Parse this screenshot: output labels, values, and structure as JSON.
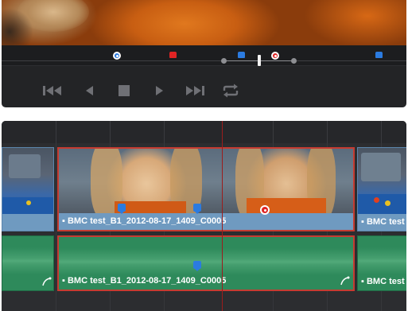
{
  "viewer": {
    "scrubber_markers": [
      {
        "name": "marker-blue-ring",
        "color": "#2b7be0",
        "style": "ring"
      },
      {
        "name": "marker-red",
        "color": "#e02424",
        "style": "flag"
      },
      {
        "name": "marker-blue",
        "color": "#2b7be0",
        "style": "flag"
      },
      {
        "name": "marker-red-ring",
        "color": "#e02424",
        "style": "ring"
      },
      {
        "name": "marker-blue",
        "color": "#2b7be0",
        "style": "flag"
      }
    ],
    "transport_controls": [
      "jump-to-start-icon",
      "play-reverse-icon",
      "stop-icon",
      "play-icon",
      "jump-to-end-icon",
      "loop-icon"
    ]
  },
  "timeline": {
    "video_clips": [
      {
        "label": "",
        "selected": false
      },
      {
        "label": "BMC test_B1_2012-08-17_1409_C0005",
        "selected": true
      },
      {
        "label": "BMC test",
        "selected": false
      }
    ],
    "audio_clips": [
      {
        "label": "",
        "selected": false
      },
      {
        "label": "BMC test_B1_2012-08-17_1409_C0005",
        "selected": true
      },
      {
        "label": "BMC test",
        "selected": false
      }
    ],
    "colors": {
      "video_clip": "#7da4c7",
      "audio_clip": "#2e8a5b",
      "selection": "#c63b31",
      "playhead": "#9b1d1d",
      "marker_blue": "#2b7be0",
      "marker_red": "#e02424"
    }
  }
}
